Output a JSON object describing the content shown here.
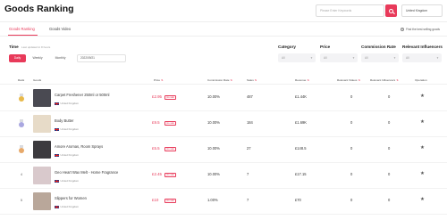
{
  "header": {
    "title": "Goods Ranking",
    "search_placeholder": "Please Enter Keywords",
    "region": "United Kingdom"
  },
  "tabs": [
    {
      "label": "Goods Ranking",
      "active": true
    },
    {
      "label": "Goods Video",
      "active": false
    }
  ],
  "tip": "Find the best selling goods",
  "filters": {
    "time_label": "Time",
    "time_sub": "Last updated in 8 hours",
    "periods": [
      "Daily",
      "Weekly",
      "Monthly"
    ],
    "active_period": "Daily",
    "date_value": "2022/09/21",
    "category_label": "Category",
    "category_value": "All",
    "price_label": "Price",
    "price_value": "All",
    "commission_label": "Commission Rate",
    "commission_value": "All",
    "influencers_label": "Relevant Influencers",
    "influencers_value": "All"
  },
  "table": {
    "columns": [
      "Rank",
      "Goods",
      "Price",
      "Commission Rate",
      "Sales",
      "Revenue",
      "Relevant Videos",
      "Relevant Influencers",
      "Operation"
    ],
    "rows": [
      {
        "rank": "1",
        "name": "Carpet Freshener 250ml or 500ml",
        "origin": "United Kingdom",
        "price": "£2.95",
        "price_tag": "pre-sale",
        "commission": "10.00%",
        "sales": "487",
        "revenue": "£1.44K",
        "videos": "0",
        "influencers": "0",
        "medal_color": "#e8b94a",
        "thumb_color": "#4a4a52"
      },
      {
        "rank": "2",
        "name": "Body Butter",
        "origin": "United Kingdom",
        "price": "£9.5",
        "price_tag": "pre-sale",
        "commission": "10.00%",
        "sales": "184",
        "revenue": "£1.69K",
        "videos": "0",
        "influencers": "0",
        "medal_color": "#a9a7e0",
        "thumb_color": "#e7dbc8"
      },
      {
        "rank": "3",
        "name": "Amore Aromas, Room Sprays",
        "origin": "United Kingdom",
        "price": "£5.5",
        "price_tag": "pre-sale",
        "commission": "10.00%",
        "sales": "27",
        "revenue": "£148.5",
        "videos": "0",
        "influencers": "0",
        "medal_color": "#e7a96a",
        "thumb_color": "#3c3a3e"
      },
      {
        "rank": "4",
        "name": "Geo Heart Wax Melt - Home Fragrance",
        "origin": "United Kingdom",
        "price": "£2.45",
        "price_tag": "pre-sale",
        "commission": "10.00%",
        "sales": "7",
        "revenue": "£17.15",
        "videos": "0",
        "influencers": "0",
        "medal_color": "",
        "thumb_color": "#d9c9cc"
      },
      {
        "rank": "5",
        "name": "Slippers for Women",
        "origin": "United Kingdom",
        "price": "£10",
        "price_tag": "pre-sale",
        "commission": "1.00%",
        "sales": "7",
        "revenue": "£70",
        "videos": "0",
        "influencers": "0",
        "medal_color": "",
        "thumb_color": "#b9a79a"
      }
    ]
  },
  "icons": {
    "search": "search-icon",
    "star": "star-icon",
    "medal": "medal-icon",
    "flag": "flag-icon"
  },
  "colors": {
    "accent": "#e83a5a"
  }
}
